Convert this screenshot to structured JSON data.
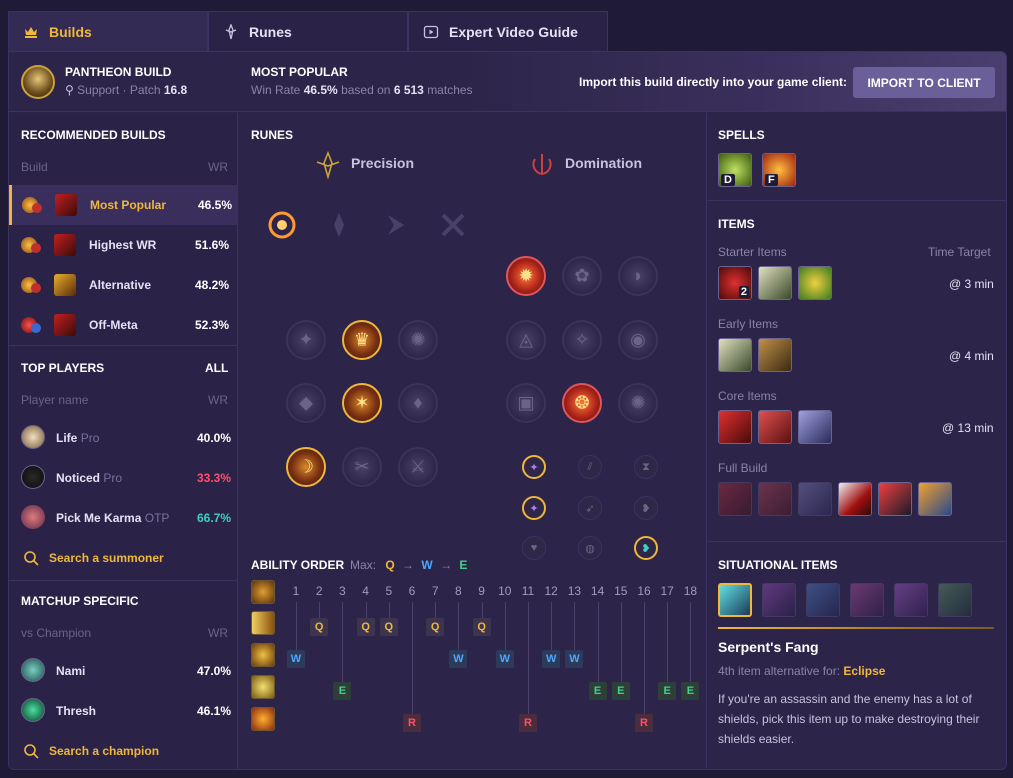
{
  "tabs": [
    {
      "label": "Builds",
      "icon": "crown-icon",
      "active": true
    },
    {
      "label": "Runes",
      "icon": "rune-icon",
      "active": false
    },
    {
      "label": "Expert Video Guide",
      "icon": "video-icon",
      "active": false
    }
  ],
  "header": {
    "champion_title": "PANTHEON BUILD",
    "role": "Support",
    "patch_label": "Patch",
    "patch": "16.8",
    "most_popular_title": "MOST POPULAR",
    "winrate_label": "Win Rate",
    "winrate": "46.5%",
    "based_on": "based on",
    "matches": "6 513",
    "matches_label": "matches",
    "import_text": "Import this build directly into your game client:",
    "import_button": "IMPORT TO CLIENT"
  },
  "recommended": {
    "title": "RECOMMENDED BUILDS",
    "col_build": "Build",
    "col_wr": "WR",
    "rows": [
      {
        "label": "Most Popular",
        "wr": "46.5%",
        "active": true
      },
      {
        "label": "Highest WR",
        "wr": "51.6%",
        "active": false
      },
      {
        "label": "Alternative",
        "wr": "48.2%",
        "active": false
      },
      {
        "label": "Off-Meta",
        "wr": "52.3%",
        "active": false
      }
    ]
  },
  "top_players": {
    "title": "TOP PLAYERS",
    "all": "ALL",
    "col_name": "Player name",
    "col_wr": "WR",
    "rows": [
      {
        "name": "Life",
        "tag": "Pro",
        "wr": "40.0%",
        "wr_color": "#ffffff"
      },
      {
        "name": "Noticed",
        "tag": "Pro",
        "wr": "33.3%",
        "wr_color": "#ff4f6a"
      },
      {
        "name": "Pick Me Karma",
        "tag": "OTP",
        "wr": "66.7%",
        "wr_color": "#3fd0c0"
      }
    ],
    "search": "Search a summoner"
  },
  "matchup": {
    "title": "MATCHUP SPECIFIC",
    "col_name": "vs Champion",
    "col_wr": "WR",
    "rows": [
      {
        "name": "Nami",
        "wr": "47.0%"
      },
      {
        "name": "Thresh",
        "wr": "46.1%"
      }
    ],
    "search": "Search a champion"
  },
  "runes": {
    "title": "RUNES",
    "primary": "Precision",
    "secondary": "Domination"
  },
  "ability_order": {
    "title": "ABILITY ORDER",
    "max_label": "Max:",
    "max_seq": [
      "Q",
      "W",
      "E"
    ],
    "levels": [
      "1",
      "2",
      "3",
      "4",
      "5",
      "6",
      "7",
      "8",
      "9",
      "10",
      "11",
      "12",
      "13",
      "14",
      "15",
      "16",
      "17",
      "18"
    ],
    "q": [
      2,
      4,
      5,
      7,
      9
    ],
    "w": [
      1,
      8,
      10,
      12,
      13
    ],
    "e": [
      3,
      14,
      15,
      17,
      18
    ],
    "r": [
      6,
      11,
      16
    ]
  },
  "spells": {
    "title": "SPELLS",
    "list": [
      {
        "key": "D"
      },
      {
        "key": "F"
      }
    ]
  },
  "items": {
    "title": "ITEMS",
    "starter_label": "Starter Items",
    "time_target": "Time Target",
    "starter_time": "@ 3 min",
    "starter_count": "2",
    "early_label": "Early Items",
    "early_time": "@ 4 min",
    "core_label": "Core Items",
    "core_time": "@ 13 min",
    "full_label": "Full Build"
  },
  "situational": {
    "title": "SITUATIONAL ITEMS",
    "item_name": "Serpent's Fang",
    "alt_text": "4th item alternative for:",
    "alt_for": "Eclipse",
    "description": "If you're an assassin and the enemy has a lot of shields, pick this item up to make destroying their shields easier."
  },
  "colors": {
    "accent": "#f0b73a",
    "q": "#f0b73a",
    "w": "#4aa8ff",
    "e": "#3fd08a",
    "r": "#ff4f6a"
  }
}
